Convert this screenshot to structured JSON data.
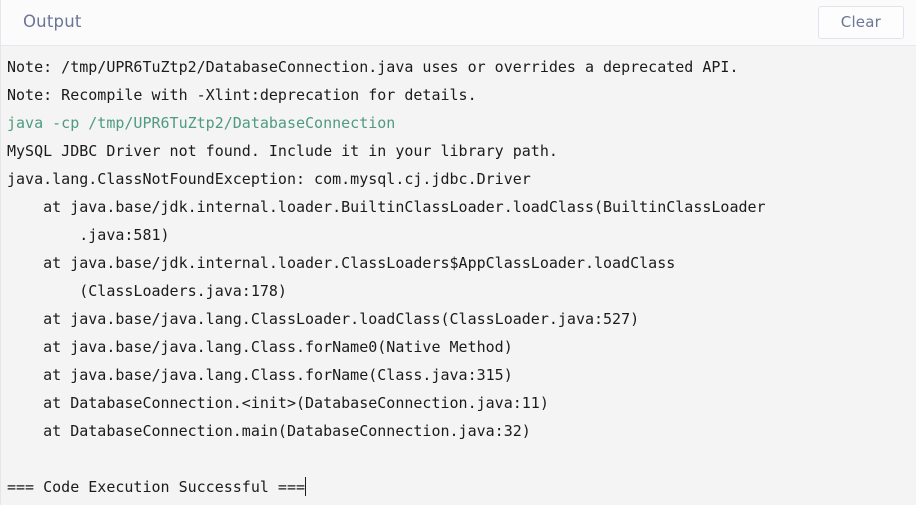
{
  "header": {
    "title": "Output",
    "clear_label": "Clear"
  },
  "colors": {
    "panel_background": "#f4f4f4",
    "header_background": "#fbfbfc",
    "title_text": "#6b7596",
    "console_text": "#1b1b1b",
    "command_text": "#4f9b80",
    "border": "#e6e8ee"
  },
  "console": {
    "lines": [
      {
        "text": "Note: /tmp/UPR6TuZtp2/DatabaseConnection.java uses or overrides a deprecated API.",
        "style": "normal"
      },
      {
        "text": "Note: Recompile with -Xlint:deprecation for details.",
        "style": "normal"
      },
      {
        "text": "java -cp /tmp/UPR6TuZtp2/DatabaseConnection",
        "style": "command"
      },
      {
        "text": "MySQL JDBC Driver not found. Include it in your library path.",
        "style": "normal"
      },
      {
        "text": "java.lang.ClassNotFoundException: com.mysql.cj.jdbc.Driver",
        "style": "normal"
      },
      {
        "text": "    at java.base/jdk.internal.loader.BuiltinClassLoader.loadClass(BuiltinClassLoader",
        "style": "normal"
      },
      {
        "text": "        .java:581)",
        "style": "normal"
      },
      {
        "text": "    at java.base/jdk.internal.loader.ClassLoaders$AppClassLoader.loadClass",
        "style": "normal"
      },
      {
        "text": "        (ClassLoaders.java:178)",
        "style": "normal"
      },
      {
        "text": "    at java.base/java.lang.ClassLoader.loadClass(ClassLoader.java:527)",
        "style": "normal"
      },
      {
        "text": "    at java.base/java.lang.Class.forName0(Native Method)",
        "style": "normal"
      },
      {
        "text": "    at java.base/java.lang.Class.forName(Class.java:315)",
        "style": "normal"
      },
      {
        "text": "    at DatabaseConnection.<init>(DatabaseConnection.java:11)",
        "style": "normal"
      },
      {
        "text": "    at DatabaseConnection.main(DatabaseConnection.java:32)",
        "style": "normal"
      },
      {
        "text": "",
        "style": "blank"
      },
      {
        "text": "=== Code Execution Successful ===",
        "style": "normal",
        "caret": true
      }
    ]
  }
}
